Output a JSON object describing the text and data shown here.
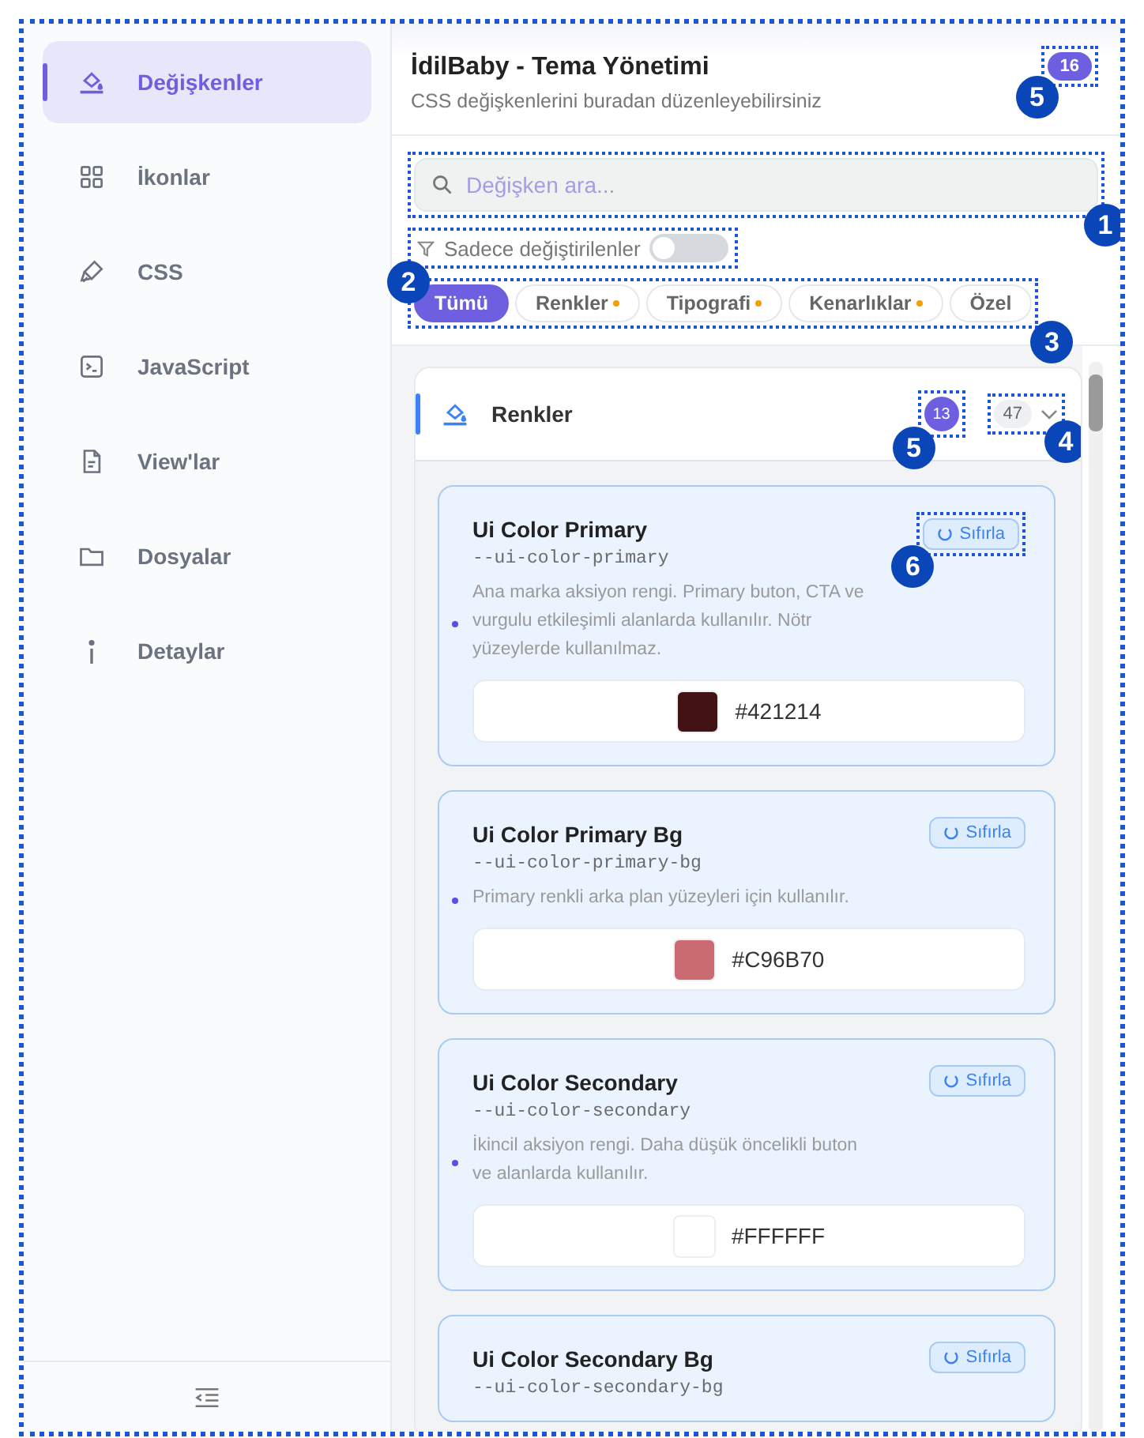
{
  "sidebar": {
    "items": [
      {
        "label": "Değişkenler",
        "selected": true
      },
      {
        "label": "İkonlar",
        "selected": false
      },
      {
        "label": "CSS",
        "selected": false
      },
      {
        "label": "JavaScript",
        "selected": false
      },
      {
        "label": "View'lar",
        "selected": false
      },
      {
        "label": "Dosyalar",
        "selected": false
      },
      {
        "label": "Detaylar",
        "selected": false
      }
    ]
  },
  "header": {
    "title": "İdilBaby - Tema Yönetimi",
    "subtitle": "CSS değişkenlerini buradan düzenleyebilirsiniz",
    "badge": {
      "text": "16",
      "callout": "5"
    }
  },
  "search": {
    "placeholder": "Değişken ara...",
    "callout": "1"
  },
  "filter": {
    "label": "Sadece değiştirilenler",
    "on": false,
    "callout": "2"
  },
  "chips": {
    "callout": "3",
    "items": [
      {
        "label": "Tümü",
        "selected": true,
        "modified": false
      },
      {
        "label": "Renkler",
        "selected": false,
        "modified": true
      },
      {
        "label": "Tipografi",
        "selected": false,
        "modified": true
      },
      {
        "label": "Kenarlıklar",
        "selected": false,
        "modified": true
      },
      {
        "label": "Özel",
        "selected": false,
        "modified": false
      }
    ]
  },
  "section": {
    "title": "Renkler",
    "badge": {
      "text": "13",
      "callout": "5"
    },
    "count": {
      "text": "47",
      "callout": "4"
    },
    "expanded": true,
    "cards": [
      {
        "name": "Ui Color Primary",
        "variable": "--ui-color-primary",
        "description": "Ana marka aksiyon rengi. Primary buton, CTA ve vurgulu etkileşimli alanlarda kullanılır. Nötr yüzeylerde kullanılmaz.",
        "modified": true,
        "value": "#421214",
        "color": "#421214",
        "reset": {
          "label": "Sıfırla",
          "callout": "6"
        }
      },
      {
        "name": "Ui Color Primary Bg",
        "variable": "--ui-color-primary-bg",
        "description": "Primary renkli arka plan yüzeyleri için kullanılır.",
        "modified": true,
        "value": "#C96B70",
        "color": "#c96b70",
        "reset": {
          "label": "Sıfırla"
        }
      },
      {
        "name": "Ui Color Secondary",
        "variable": "--ui-color-secondary",
        "description": "İkincil aksiyon rengi. Daha düşük öncelikli buton ve alanlarda kullanılır.",
        "modified": true,
        "value": "#FFFFFF",
        "color": "#ffffff",
        "reset": {
          "label": "Sıfırla"
        }
      },
      {
        "name": "Ui Color Secondary Bg",
        "variable": "--ui-color-secondary-bg",
        "reset": {
          "label": "Sıfırla"
        }
      }
    ]
  }
}
